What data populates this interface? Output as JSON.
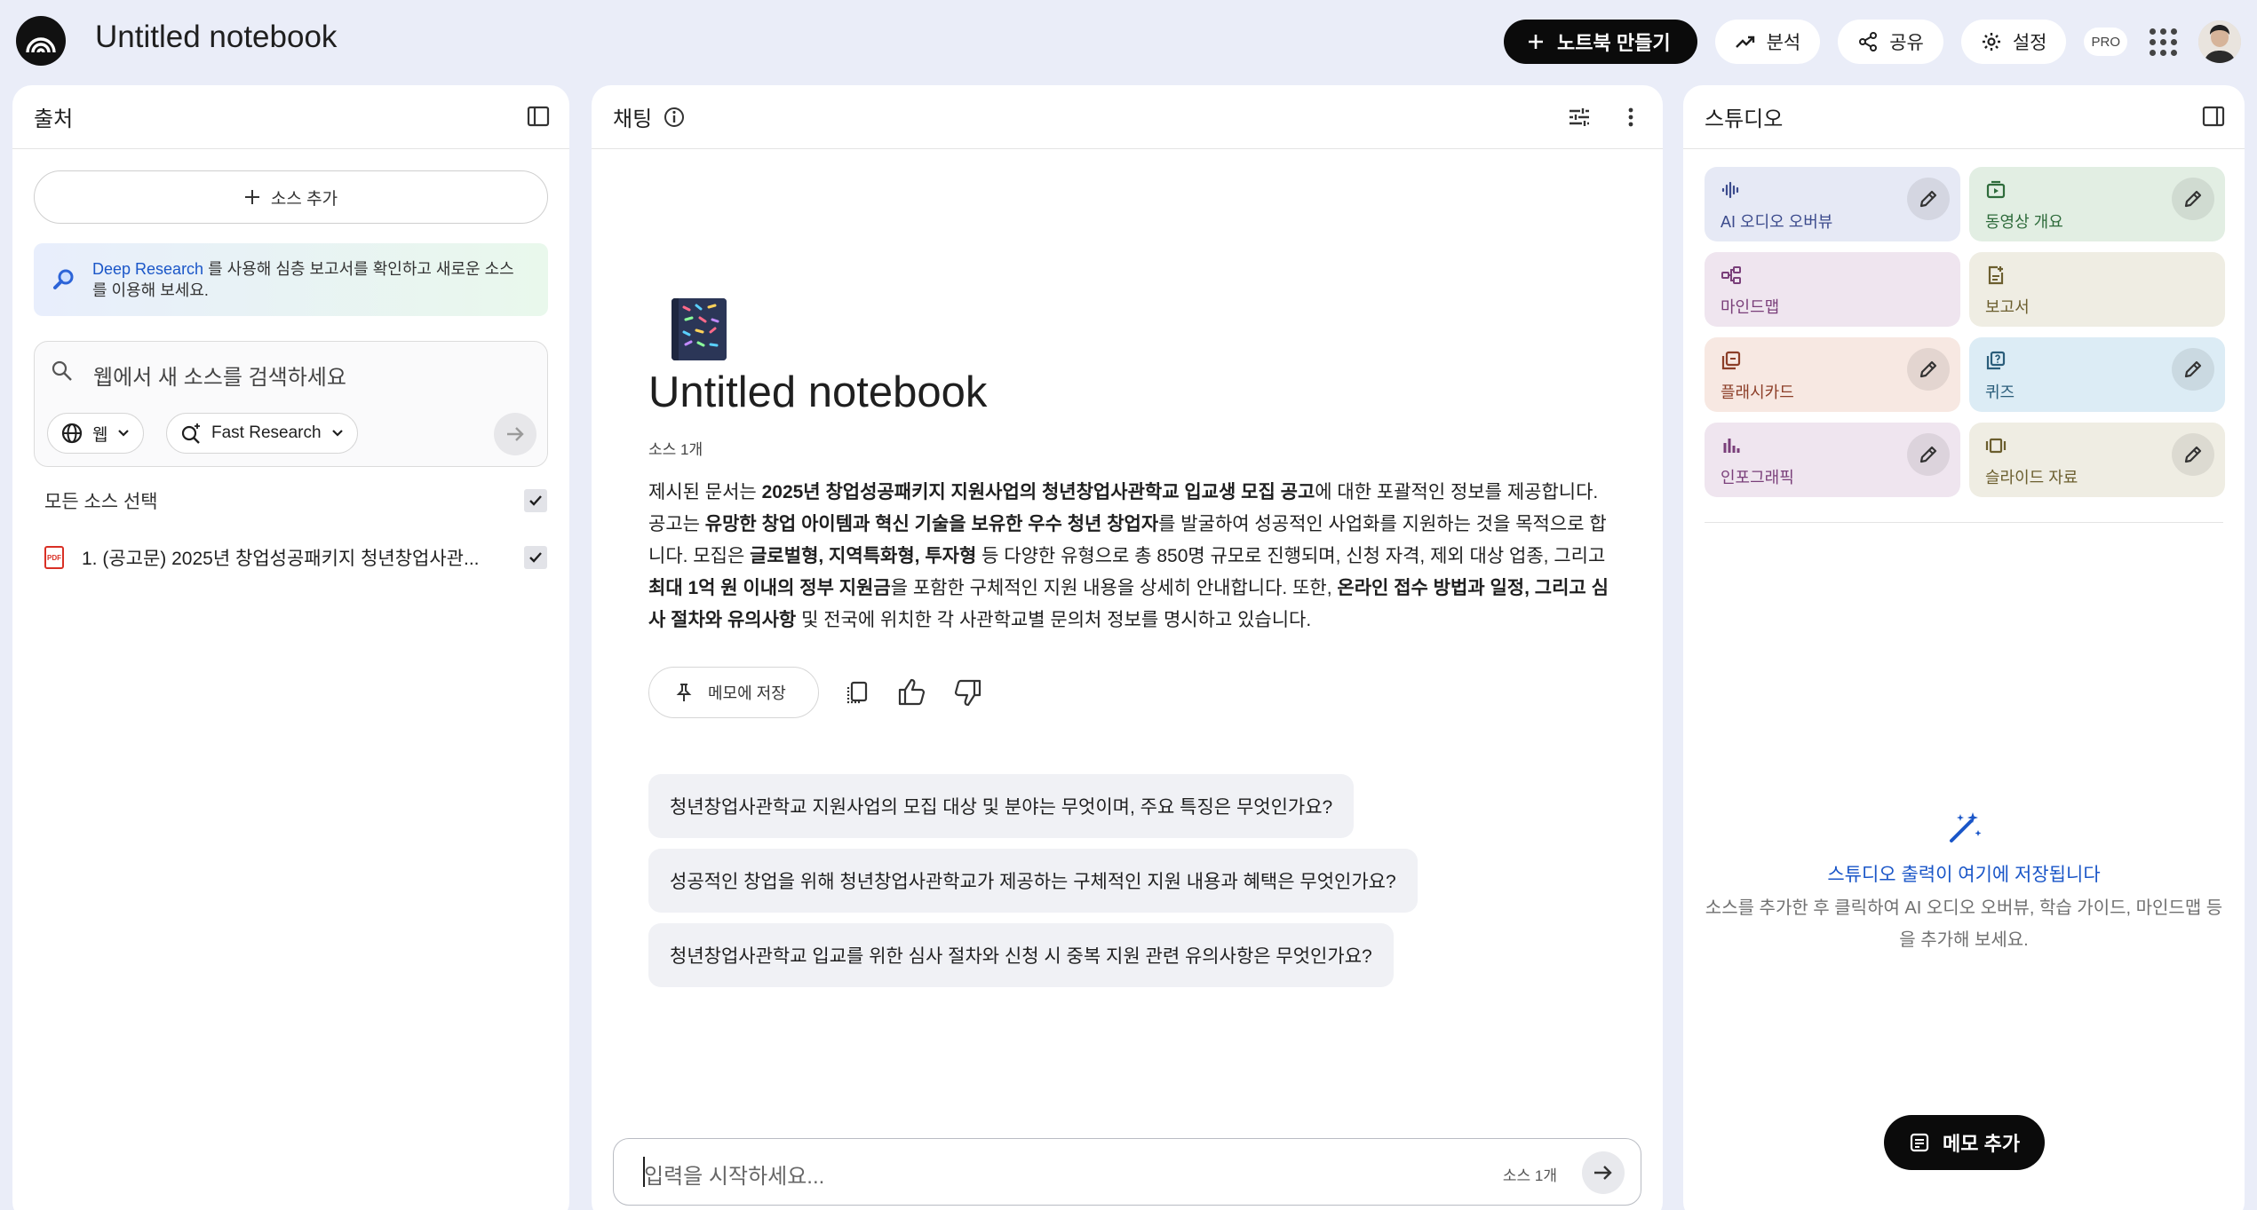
{
  "app": {
    "title": "Untitled notebook"
  },
  "topbar": {
    "create_label": "노트북 만들기",
    "analytics_label": "분석",
    "share_label": "공유",
    "settings_label": "설정",
    "pro_label": "PRO"
  },
  "sources": {
    "title": "출처",
    "add_label": "소스 추가",
    "deep_link": "Deep Research",
    "deep_text": "를 사용해 심층 보고서를 확인하고 새로운 소스를 이용해 보세요.",
    "search_placeholder": "웹에서 새 소스를 검색하세요",
    "web_label": "웹",
    "mode_label": "Fast Research",
    "select_all_label": "모든 소스 선택",
    "files": [
      {
        "name": "1. (공고문) 2025년 창업성공패키지 청년창업사관...",
        "type_badge": "PDF"
      }
    ]
  },
  "chat": {
    "title": "채팅",
    "notebook_title": "Untitled notebook",
    "source_count": "소스 1개",
    "summary": [
      {
        "t": "제시된 문서는 ",
        "b": false
      },
      {
        "t": "2025년 창업성공패키지 지원사업의 청년창업사관학교 입교생 모집 공고",
        "b": true
      },
      {
        "t": "에 대한 포괄적인 정보를 제공합니다. 공고는 ",
        "b": false
      },
      {
        "t": "유망한 창업 아이템과 혁신 기술을 보유한 우수 청년 창업자",
        "b": true
      },
      {
        "t": "를 발굴하여 성공적인 사업화를 지원하는 것을 목적으로 합니다. 모집은 ",
        "b": false
      },
      {
        "t": "글로벌형, 지역특화형, 투자형",
        "b": true
      },
      {
        "t": " 등 다양한 유형으로 총 850명 규모로 진행되며, 신청 자격, 제외 대상 업종, 그리고 ",
        "b": false
      },
      {
        "t": "최대 1억 원 이내의 정부 지원금",
        "b": true
      },
      {
        "t": "을 포함한 구체적인 지원 내용을 상세히 안내합니다. 또한, ",
        "b": false
      },
      {
        "t": "온라인 접수 방법과 일정, 그리고 심사 절차와 유의사항",
        "b": true
      },
      {
        "t": " 및 전국에 위치한 각 사관학교별 문의처 정보를 명시하고 있습니다.",
        "b": false
      }
    ],
    "save_memo_label": "메모에 저장",
    "suggestions": [
      "청년창업사관학교 지원사업의 모집 대상 및 분야는 무엇이며, 주요 특징은 무엇인가요?",
      "성공적인 창업을 위해 청년창업사관학교가 제공하는 구체적인 지원 내용과 혜택은 무엇인가요?",
      "청년창업사관학교 입교를 위한 심사 절차와 신청 시 중복 지원 관련 유의사항은 무엇인가요?"
    ],
    "input_placeholder": "입력을 시작하세요...",
    "input_source_count": "소스 1개"
  },
  "studio": {
    "title": "스튜디오",
    "tiles": [
      {
        "label": "AI 오디오 오버뷰",
        "bg": "#e6e9f5",
        "fg": "#3b4a8c",
        "icon": "audio-wave-icon",
        "editable": true
      },
      {
        "label": "동영상 개요",
        "bg": "#e2eee3",
        "fg": "#2e6b3b",
        "icon": "video-icon",
        "editable": true
      },
      {
        "label": "마인드맵",
        "bg": "#efe5ef",
        "fg": "#7a3f7a",
        "icon": "mindmap-icon",
        "editable": false
      },
      {
        "label": "보고서",
        "bg": "#efede3",
        "fg": "#6b5e2e",
        "icon": "report-icon",
        "editable": false
      },
      {
        "label": "플래시카드",
        "bg": "#f7e8e2",
        "fg": "#8c3e28",
        "icon": "flashcard-icon",
        "editable": true
      },
      {
        "label": "퀴즈",
        "bg": "#dcecf5",
        "fg": "#2a5d7a",
        "icon": "quiz-icon",
        "editable": true
      },
      {
        "label": "인포그래픽",
        "bg": "#efe5ef",
        "fg": "#7a3f7a",
        "icon": "infographic-icon",
        "editable": true
      },
      {
        "label": "슬라이드 자료",
        "bg": "#efede3",
        "fg": "#6b5e2e",
        "icon": "slides-icon",
        "editable": true
      }
    ],
    "empty_title": "스튜디오 출력이 여기에 저장됩니다",
    "empty_desc": "소스를 추가한 후 클릭하여 AI 오디오 오버뷰, 학습 가이드, 마인드맵 등을 추가해 보세요.",
    "add_note_label": "메모 추가"
  }
}
